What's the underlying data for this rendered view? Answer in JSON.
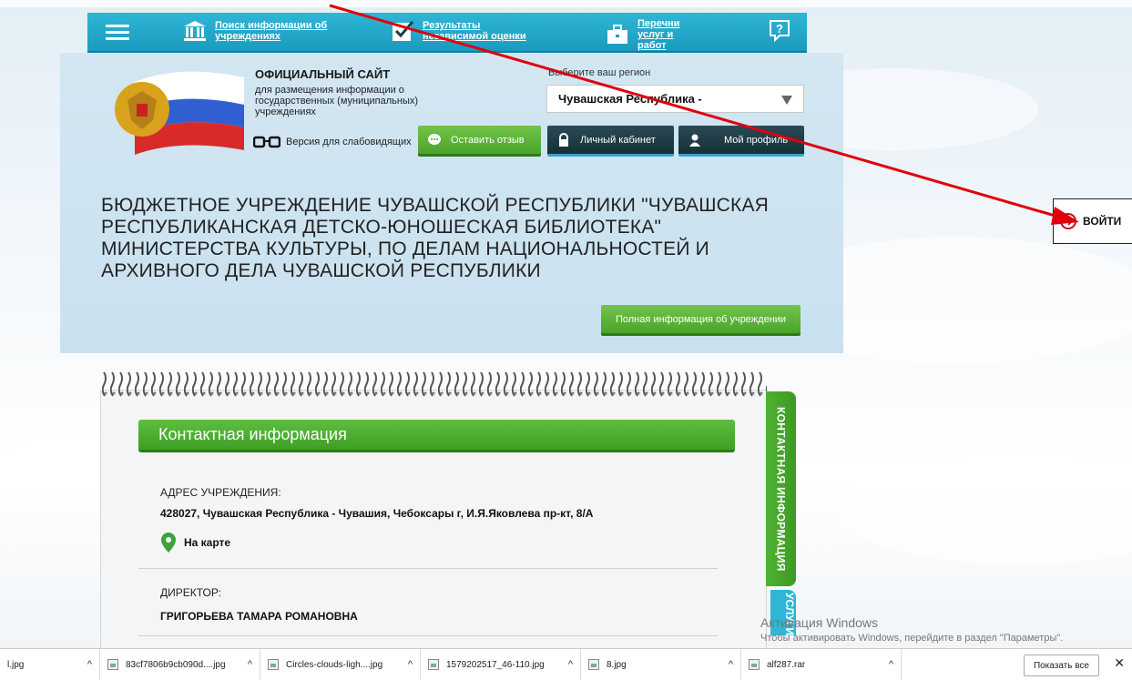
{
  "nav": {
    "search_label": "Поиск информации об учреждениях",
    "results_label": "Результаты независимой оценки",
    "lists_label": "Перечни услуг и работ"
  },
  "header": {
    "site_title": "ОФИЦИАЛЬНЫЙ САЙТ",
    "site_desc": "для размещения информации о государственных (муниципальных) учреждениях",
    "weak_vision": "Версия для слабовидящих",
    "region_label": "Выберите ваш регион",
    "region_value": "Чувашская Республика -",
    "feedback_button": "Оставить отзыв",
    "cabinet_button": "Личный кабинет",
    "profile_button": "Мой профиль"
  },
  "org": {
    "name": "Бюджетное учреждение Чувашской Республики \"Чувашская республиканская детско-юношеская библиотека\" Министерства культуры, по делам национальностей и архивного дела Чувашской Республики",
    "full_info_button": "Полная информация об учреждении"
  },
  "contact": {
    "section_title": "Контактная информация",
    "side_tab": "КОНТАКТНАЯ ИНФОРМАЦИЯ",
    "side_tab2": "УСЛУГИ",
    "address_label": "Адрес учреждения:",
    "address_value": "428027, Чувашская Республика - Чувашия, Чебоксары г, И.Я.Яковлева пр-кт, 8/А",
    "map_link": "На карте",
    "director_label": "Директор:",
    "director_value": "ГРИГОРЬЕВА ТАМАРА РОМАНОВНА"
  },
  "login": {
    "label": "ВОЙТИ"
  },
  "watermark": {
    "line1": "Активация Windows",
    "line2": "Чтобы активировать Windows, перейдите в раздел \"Параметры\"."
  },
  "downloads": {
    "items": [
      {
        "name": "l.jpg"
      },
      {
        "name": "83cf7806b9cb090d....jpg"
      },
      {
        "name": "Circles-clouds-ligh....jpg"
      },
      {
        "name": "1579202517_46-110.jpg"
      },
      {
        "name": "8.jpg"
      },
      {
        "name": "alf287.rar"
      }
    ],
    "show_all": "Показать все",
    "close": "✕"
  },
  "colors": {
    "nav_blue": "#1a9bbd",
    "green": "#4aa52a",
    "dark_button": "#163039",
    "arrow_red": "#e0000b"
  }
}
